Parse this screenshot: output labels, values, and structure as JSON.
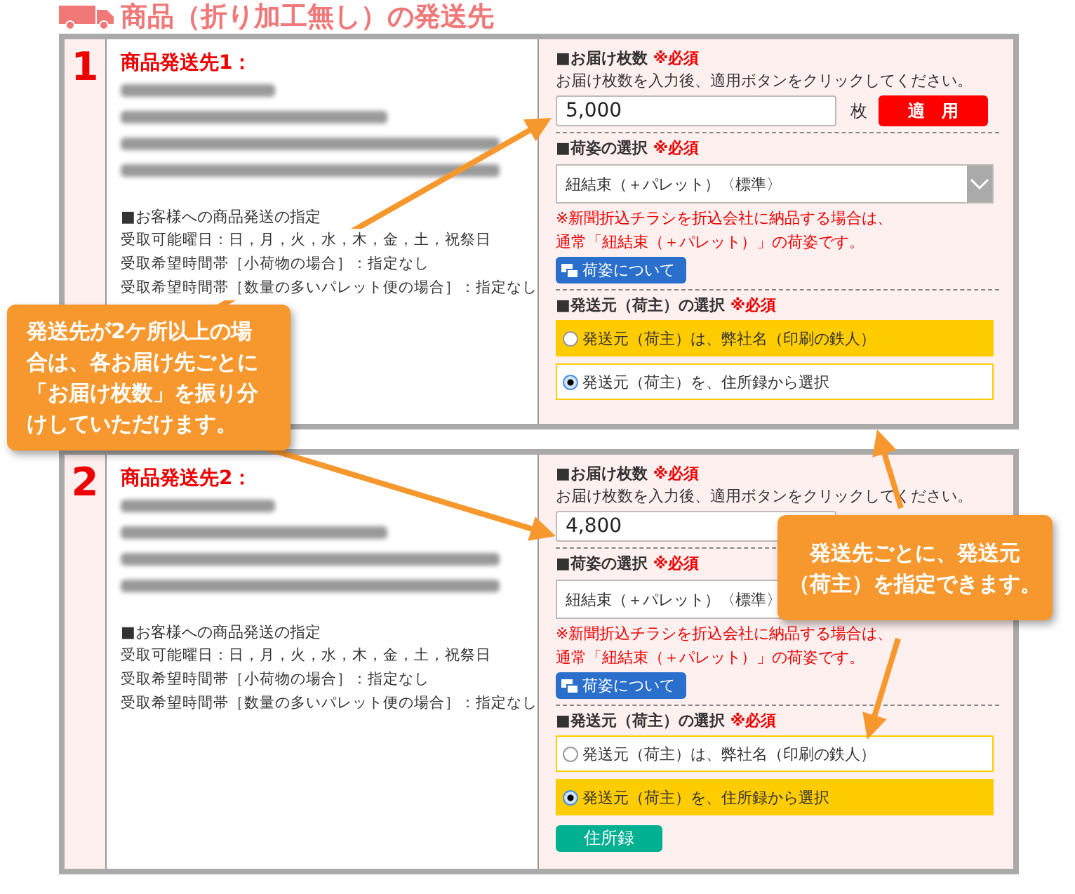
{
  "section_title": "商品（折り加工無し）の発送先",
  "destinations": [
    {
      "number": "1",
      "heading": "商品発送先1：",
      "spec_title": "■お客様への商品発送の指定",
      "spec_lines": [
        "受取可能曜日：日，月，火，水，木，金，土，祝祭日",
        "受取希望時間帯［小荷物の場合］：指定なし",
        "受取希望時間帯［数量の多いパレット便の場合］：指定なし"
      ],
      "quantity": {
        "label": "■お届け枚数",
        "required": "※必須",
        "instruction": "お届け枚数を入力後、適用ボタンをクリックしてください。",
        "value": "5,000",
        "unit": "枚",
        "apply_button": "適　用"
      },
      "packing": {
        "label": "■荷姿の選択",
        "required": "※必須",
        "value": "紐結束（＋パレット）〈標準〉",
        "notes": [
          "※新聞折込チラシを折込会社に納品する場合は、",
          "通常「紐結束（＋パレット）」の荷姿です。"
        ],
        "help_button": "荷姿について"
      },
      "sender": {
        "label": "■発送元（荷主）の選択",
        "required": "※必須",
        "options": [
          {
            "label": "発送元（荷主）は、弊社名（印刷の鉄人）",
            "selected": false,
            "highlighted": true
          },
          {
            "label": "発送元（荷主）を、住所録から選択",
            "selected": true,
            "highlighted": false
          }
        ]
      }
    },
    {
      "number": "2",
      "heading": "商品発送先2：",
      "spec_title": "■お客様への商品発送の指定",
      "spec_lines": [
        "受取可能曜日：日，月，火，水，木，金，土，祝祭日",
        "受取希望時間帯［小荷物の場合］：指定なし",
        "受取希望時間帯［数量の多いパレット便の場合］：指定なし"
      ],
      "quantity": {
        "label": "■お届け枚数",
        "required": "※必須",
        "instruction": "お届け枚数を入力後、適用ボタンをクリックしてください。",
        "value": "4,800"
      },
      "packing": {
        "label": "■荷姿の選択",
        "required": "※必須",
        "value": "紐結束（＋パレット）〈標準〉",
        "arrow_visible": false,
        "notes": [
          "※新聞折込チラシを折込会社に納品する場合は、",
          "通常「紐結束（＋パレット）」の荷姿です。"
        ],
        "help_button": "荷姿について"
      },
      "sender": {
        "label": "■発送元（荷主）の選択",
        "required": "※必須",
        "options": [
          {
            "label": "発送元（荷主）は、弊社名（印刷の鉄人）",
            "selected": false,
            "highlighted": false
          },
          {
            "label": "発送元（荷主）を、住所録から選択",
            "selected": true,
            "highlighted": true
          }
        ],
        "address_book_button": "住所録"
      }
    }
  ],
  "callouts": [
    {
      "lines": [
        "発送先が2ケ所以上の場",
        "合は、各お届け先ごとに",
        "「お届け枚数」を振り分",
        "けしていただけます。"
      ]
    },
    {
      "lines": [
        "発送先ごとに、発送元",
        "（荷主）を指定できます。"
      ]
    }
  ]
}
